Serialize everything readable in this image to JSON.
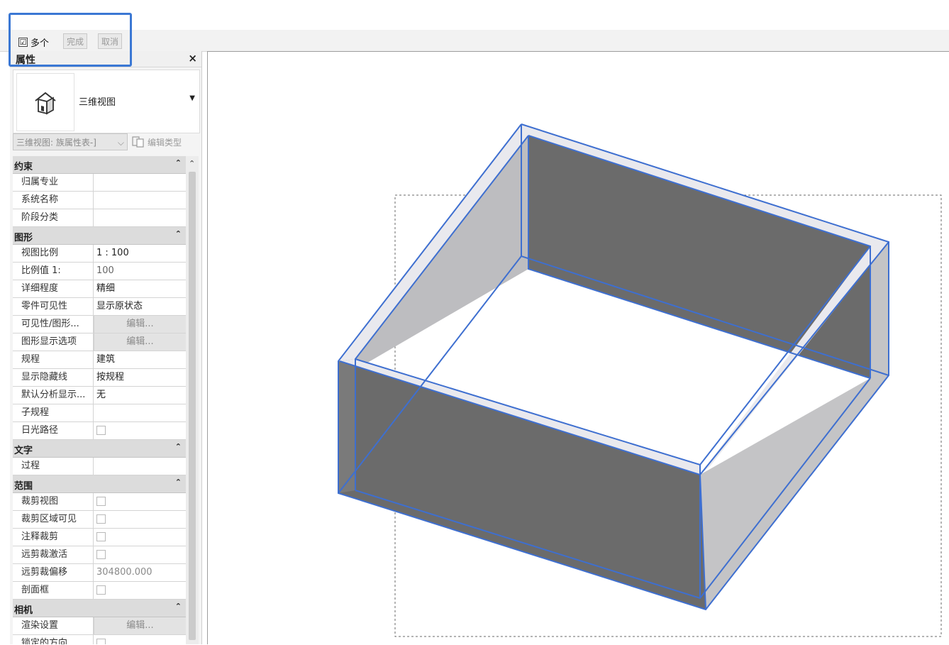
{
  "options_bar": {
    "multiple_label": "多个",
    "multiple_checked": "☑",
    "finish_label": "完成",
    "cancel_label": "取消"
  },
  "panel": {
    "title": "属性",
    "close_glyph": "×",
    "type_name": "三维视图",
    "type_icon": "house-3d-icon",
    "instance_selector": "三维视图: 族属性表-]",
    "edit_type_label": "编辑类型"
  },
  "properties": {
    "constraints": {
      "label": "约束",
      "toggle": "⌃",
      "rows": [
        {
          "name": "归属专业",
          "value": ""
        },
        {
          "name": "系统名称",
          "value": ""
        },
        {
          "name": "阶段分类",
          "value": ""
        }
      ]
    },
    "graphics": {
      "label": "图形",
      "toggle": "⌃",
      "rows": [
        {
          "name": "视图比例",
          "value": "1 : 100"
        },
        {
          "name": "比例值 1:",
          "value": "100"
        },
        {
          "name": "详细程度",
          "value": "精细"
        },
        {
          "name": "零件可见性",
          "value": "显示原状态"
        },
        {
          "name": "可见性/图形...",
          "value": "编辑..."
        },
        {
          "name": "图形显示选项",
          "value": "编辑..."
        },
        {
          "name": "规程",
          "value": "建筑"
        },
        {
          "name": "显示隐藏线",
          "value": "按规程"
        },
        {
          "name": "默认分析显示...",
          "value": "无"
        },
        {
          "name": "子规程",
          "value": ""
        },
        {
          "name": "日光路径",
          "value": ""
        }
      ]
    },
    "text": {
      "label": "文字",
      "toggle": "⌃",
      "rows": [
        {
          "name": "过程",
          "value": ""
        }
      ]
    },
    "extents": {
      "label": "范围",
      "toggle": "⌃",
      "rows": [
        {
          "name": "裁剪视图",
          "value": ""
        },
        {
          "name": "裁剪区域可见",
          "value": ""
        },
        {
          "name": "注释裁剪",
          "value": ""
        },
        {
          "name": "远剪裁激活",
          "value": ""
        },
        {
          "name": "远剪裁偏移",
          "value": "304800.000"
        },
        {
          "name": "剖面框",
          "value": ""
        }
      ]
    },
    "camera": {
      "label": "相机",
      "toggle": "⌃",
      "rows": [
        {
          "name": "渲染设置",
          "value": "编辑..."
        },
        {
          "name": "锁定的方向",
          "value": ""
        }
      ]
    }
  },
  "scroll": {
    "up_glyph": "⌃"
  },
  "colors": {
    "highlight": "#3b78d4",
    "edge": "#3e6fd0",
    "dark_face": "#6b6b6b",
    "light_face": "#c4c4c6",
    "top_face": "#e9e9ee"
  }
}
